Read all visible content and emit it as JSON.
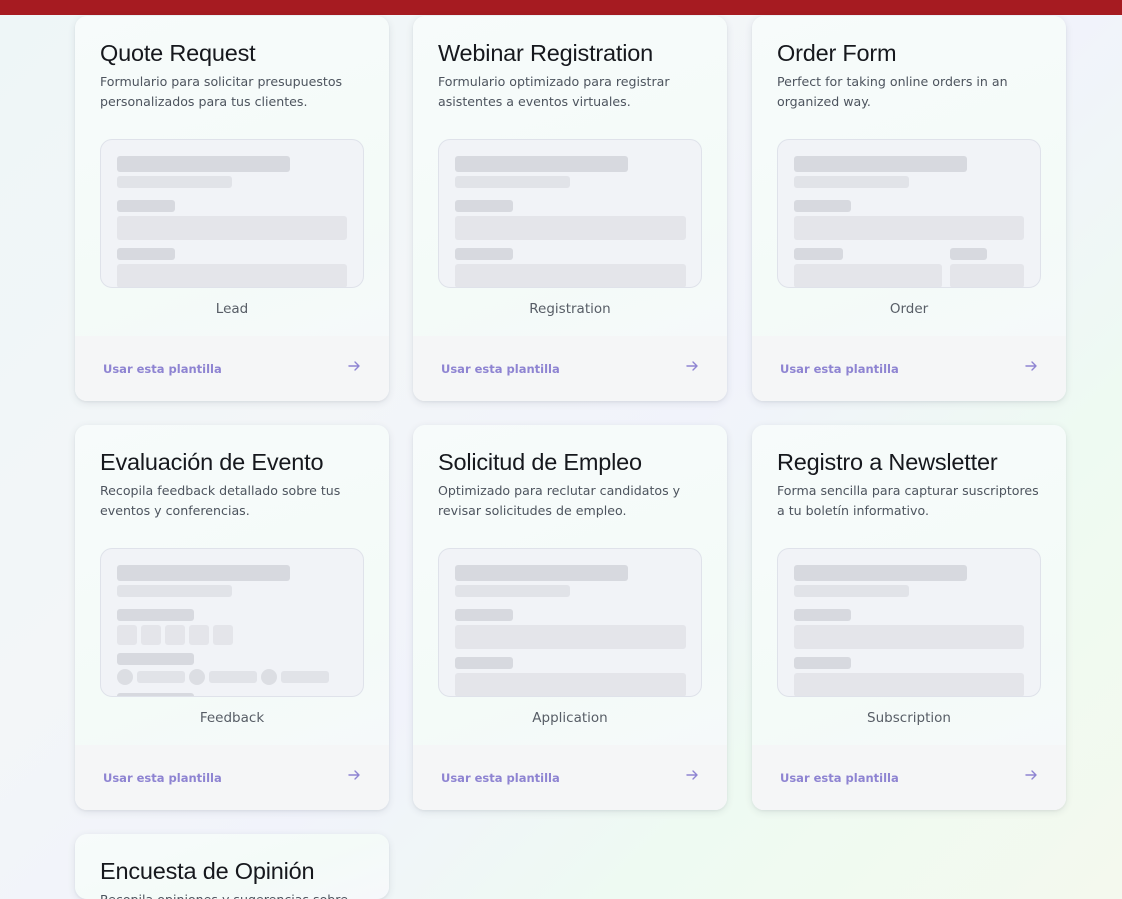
{
  "cards": [
    {
      "title": "Quote Request",
      "description": "Formulario para solicitar presupuestos personalizados para tus clientes.",
      "category": "Lead",
      "cta": "Usar esta plantilla"
    },
    {
      "title": "Webinar Registration",
      "description": "Formulario optimizado para registrar asistentes a eventos virtuales.",
      "category": "Registration",
      "cta": "Usar esta plantilla"
    },
    {
      "title": "Order Form",
      "description": "Perfect for taking online orders in an organized way.",
      "category": "Order",
      "cta": "Usar esta plantilla"
    },
    {
      "title": "Evaluación de Evento",
      "description": "Recopila feedback detallado sobre tus eventos y conferencias.",
      "category": "Feedback",
      "cta": "Usar esta plantilla"
    },
    {
      "title": "Solicitud de Empleo",
      "description": "Optimizado para reclutar candidatos y revisar solicitudes de empleo.",
      "category": "Application",
      "cta": "Usar esta plantilla"
    },
    {
      "title": "Registro a Newsletter",
      "description": "Forma sencilla para capturar suscriptores a tu boletín informativo.",
      "category": "Subscription",
      "cta": "Usar esta plantilla"
    },
    {
      "title": "Encuesta de Opinión",
      "description": "Recopila opiniones y sugerencias sobre",
      "category": "",
      "cta": ""
    }
  ],
  "icons": {
    "arrow": "arrow-right-icon"
  },
  "colors": {
    "topbar": "#a61b21",
    "link": "#8e84d2"
  }
}
